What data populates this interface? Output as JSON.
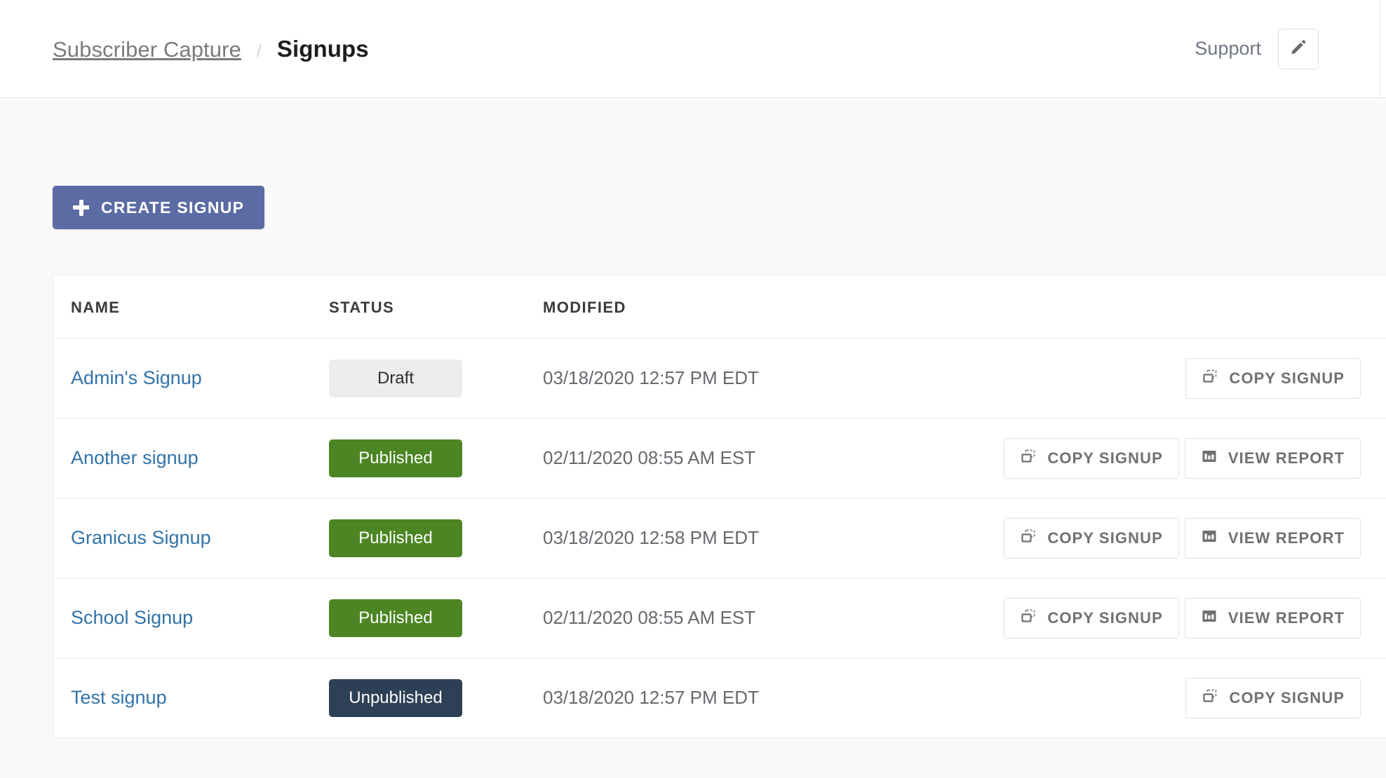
{
  "header": {
    "breadcrumb_parent": "Subscriber Capture",
    "breadcrumb_separator": "/",
    "breadcrumb_current": "Signups",
    "support_label": "Support",
    "edit_icon": "pencil-icon"
  },
  "toolbar": {
    "create_label": "CREATE SIGNUP",
    "create_icon": "plus-icon",
    "create_bg": "#5b6ba4"
  },
  "table": {
    "columns": [
      "NAME",
      "STATUS",
      "MODIFIED"
    ],
    "actions": {
      "copy_label": "COPY SIGNUP",
      "copy_icon": "copy-icon",
      "report_label": "VIEW REPORT",
      "report_icon": "bar-chart-icon"
    },
    "status_colors": {
      "Draft": "#ececec",
      "Published": "#4c8523",
      "Unpublished": "#2e4055"
    },
    "rows": [
      {
        "name": "Admin's Signup",
        "status": "Draft",
        "status_kind": "draft",
        "modified": "03/18/2020 12:57 PM EDT",
        "has_report": false
      },
      {
        "name": "Another signup",
        "status": "Published",
        "status_kind": "published",
        "modified": "02/11/2020 08:55 AM EST",
        "has_report": true
      },
      {
        "name": "Granicus Signup",
        "status": "Published",
        "status_kind": "published",
        "modified": "03/18/2020 12:58 PM EDT",
        "has_report": true
      },
      {
        "name": "School Signup",
        "status": "Published",
        "status_kind": "published",
        "modified": "02/11/2020 08:55 AM EST",
        "has_report": true
      },
      {
        "name": "Test signup",
        "status": "Unpublished",
        "status_kind": "unpublished",
        "modified": "03/18/2020 12:57 PM EDT",
        "has_report": false
      }
    ]
  }
}
